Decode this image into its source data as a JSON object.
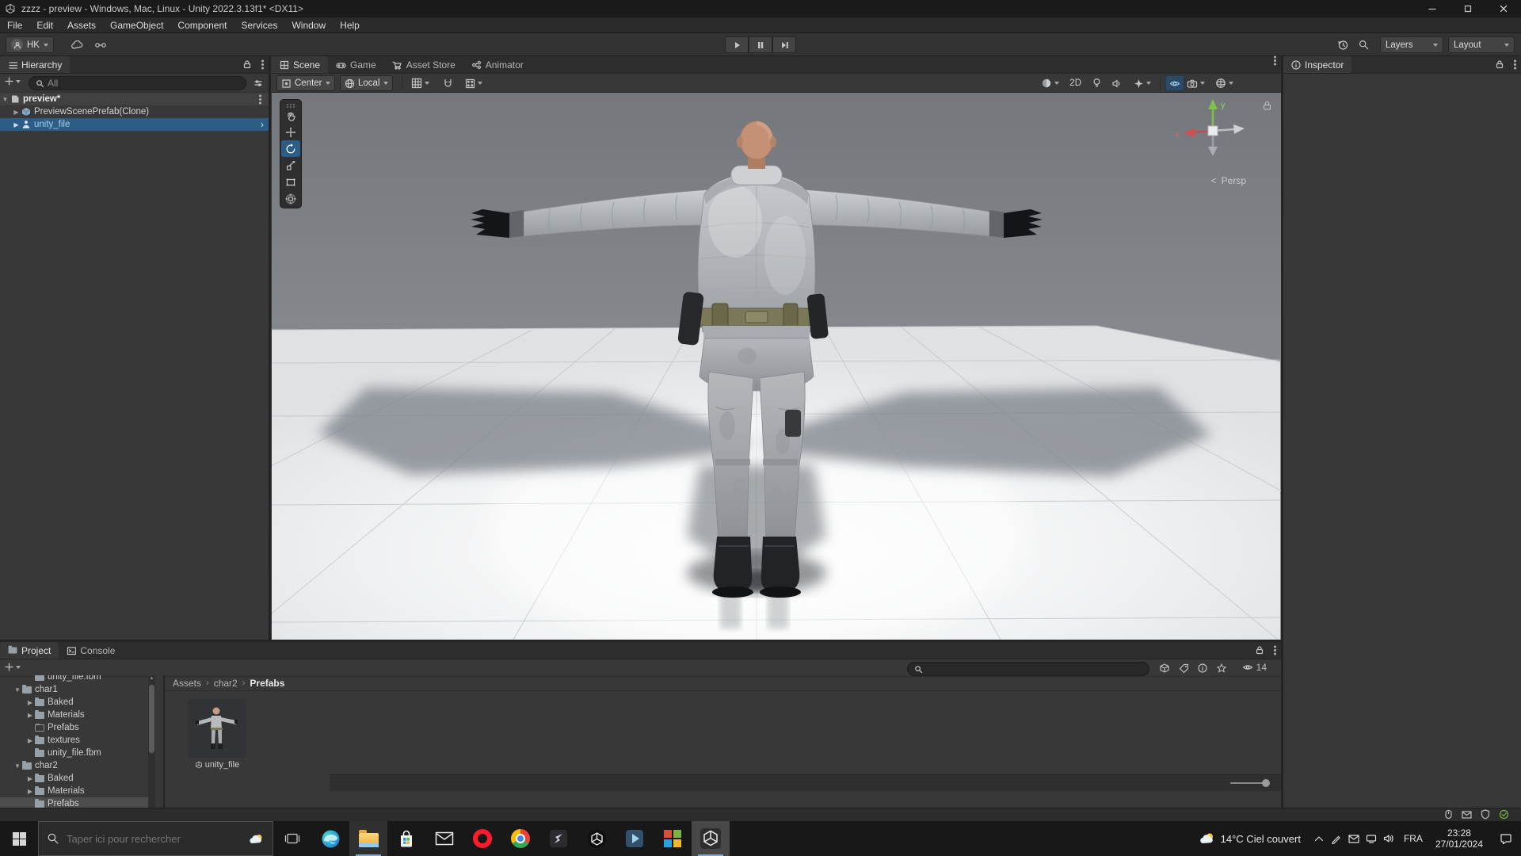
{
  "titlebar": {
    "title": "zzzz - preview - Windows, Mac, Linux - Unity 2022.3.13f1* <DX11>"
  },
  "menubar": {
    "items": [
      "File",
      "Edit",
      "Assets",
      "GameObject",
      "Component",
      "Services",
      "Window",
      "Help"
    ]
  },
  "toolbar": {
    "account": "HK",
    "layers": "Layers",
    "layout": "Layout"
  },
  "hierarchy": {
    "tab": "Hierarchy",
    "search_filter": "All",
    "scene": {
      "arrow": "▼",
      "label": "preview*"
    },
    "rows": [
      {
        "arrow": "▶",
        "label": "PreviewScenePrefab(Clone)"
      },
      {
        "arrow": "▶",
        "label": "unity_file",
        "chevron": "›"
      }
    ]
  },
  "scene": {
    "tabs": [
      "Scene",
      "Game",
      "Asset Store",
      "Animator"
    ],
    "pivot": "Center",
    "space": "Local",
    "mode_2d": "2D",
    "axis": {
      "x": "x",
      "y": "y"
    },
    "collapse": "<",
    "projection": "Persp"
  },
  "inspector": {
    "tab": "Inspector"
  },
  "project": {
    "tab_project": "Project",
    "tab_console": "Console",
    "tree": [
      {
        "arrow": "",
        "label": "unity_file.fbm"
      },
      {
        "arrow": "▼",
        "label": "char1"
      },
      {
        "arrow": "▶",
        "label": "Baked"
      },
      {
        "arrow": "▶",
        "label": "Materials"
      },
      {
        "arrow": "",
        "label": "Prefabs"
      },
      {
        "arrow": "▶",
        "label": "textures"
      },
      {
        "arrow": "",
        "label": "unity_file.fbm"
      },
      {
        "arrow": "▼",
        "label": "char2"
      },
      {
        "arrow": "▶",
        "label": "Baked"
      },
      {
        "arrow": "▶",
        "label": "Materials"
      },
      {
        "arrow": "",
        "label": "Prefabs"
      }
    ],
    "breadcrumb": [
      "Assets",
      "char2",
      "Prefabs"
    ],
    "asset": {
      "label": "unity_file"
    },
    "hidden_count": "14"
  },
  "taskbar": {
    "search_placeholder": "Taper ici pour rechercher",
    "weather": "14°C Ciel couvert",
    "language": "FRA",
    "time": "23:28",
    "date": "27/01/2024"
  },
  "colors": {
    "selection_blue": "#2c5d87",
    "unfocused_selection": "#4d4d4d",
    "prefab_text": "#a8cdf0"
  }
}
